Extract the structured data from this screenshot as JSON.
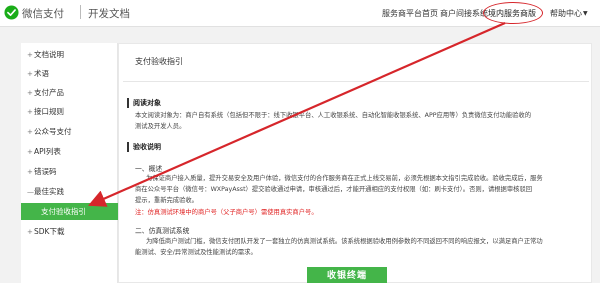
{
  "header": {
    "brand": "微信支付",
    "subtitle": "开发文档",
    "nav": [
      "服务商平台首页",
      "商户间接系统",
      "境内服务商版",
      "帮助中心"
    ]
  },
  "sidebar": {
    "items": [
      {
        "label": "文档说明",
        "expandable": true
      },
      {
        "label": "术语",
        "expandable": true
      },
      {
        "label": "支付产品",
        "expandable": true
      },
      {
        "label": "接口规则",
        "expandable": true
      },
      {
        "label": "公众号支付",
        "expandable": true
      },
      {
        "label": "API列表",
        "expandable": true
      },
      {
        "label": "错误码",
        "expandable": true
      },
      {
        "label": "最佳实践",
        "expandable": false,
        "prefix": "—"
      },
      {
        "label": "支付验收指引",
        "active": true
      },
      {
        "label": "SDK下载",
        "expandable": true
      }
    ]
  },
  "content": {
    "title": "支付验收指引",
    "section1": {
      "heading": "阅读对象",
      "lines": [
        "本文阅读对象为：商户自有系统（包括但不限于：线下收银平台、人工收银系统、自动化智能收银系统、APP应用等）负责微信支付功能验收的",
        "测试及开发人员。"
      ]
    },
    "section2": {
      "heading": "验收说明",
      "sub1": {
        "title": "一、概述",
        "lines": [
          "为保证商户接入质量，提升交易安全及用户体验，微信支付的合作服务商在正式上线交易前，必须先根据本文指引完成验收。验收完成后，服务",
          "商在公众号平台（微信号：WXPayAsst）提交验收通过申请，审核通过后，才能开通相应的支付权限（如：刷卡支付）。否则，请根据审核驳回",
          "提示，重新完成验收。"
        ],
        "warning": "注：仿真测试环境中的商户号（父子商户号）需使用真实商户号。"
      },
      "sub2": {
        "title": "二、仿真测试系统",
        "lines": [
          "为降低商户测试门槛，微信支付团队开发了一套独立的仿真测试系统。该系统根据验收用例参数的不同返回不同的响应报文，以满足商户正常功",
          "能测试、安全/异常测试及性能测试的需求。"
        ]
      }
    },
    "button_label": "收银终端"
  },
  "colors": {
    "accent_green": "#44b549",
    "annotation_red": "#d6262b"
  }
}
